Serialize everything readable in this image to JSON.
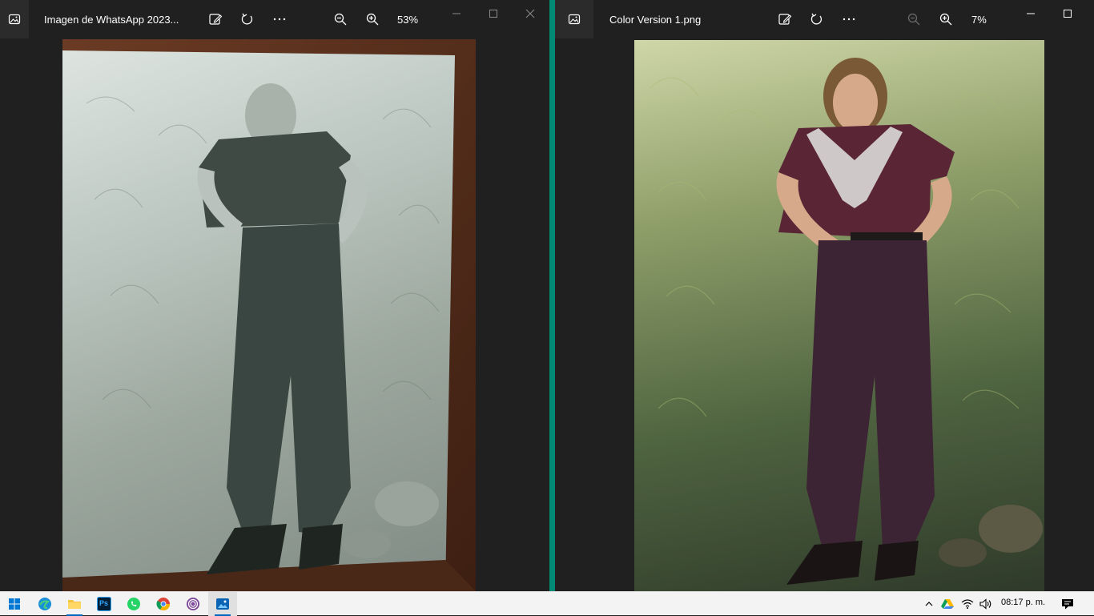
{
  "left_window": {
    "title": "Imagen de WhatsApp 2023...",
    "zoom": "53%",
    "icons": [
      "photos-app-icon",
      "edit-image-icon",
      "rotate-icon",
      "more-icon",
      "zoom-out-icon",
      "zoom-in-icon",
      "minimize-icon",
      "maximize-icon",
      "close-icon"
    ],
    "image_description_visible": "photo of a framed black-and-white portrait"
  },
  "right_window": {
    "title": "Color Version 1.png",
    "zoom": "7%",
    "icons": [
      "photos-app-icon",
      "edit-image-icon",
      "rotate-icon",
      "more-icon",
      "zoom-out-icon",
      "zoom-in-icon",
      "minimize-icon",
      "maximize-icon"
    ]
  },
  "taskbar": {
    "apps": [
      "windows-start-icon",
      "edge-icon",
      "file-explorer-icon",
      "photoshop-icon",
      "whatsapp-icon",
      "chrome-icon",
      "tor-icon",
      "photos-icon"
    ],
    "photoshop_label": "Ps",
    "tray_icons": [
      "chevron-up-icon",
      "google-drive-icon",
      "wifi-icon",
      "volume-icon",
      "notifications-icon"
    ],
    "clock": "08:17 p. m."
  },
  "colors": {
    "window_bg": "#202020",
    "accent_divider": "#008a73",
    "taskbar_bg": "#f3f3f3",
    "taskbar_active": "#0067c0"
  }
}
